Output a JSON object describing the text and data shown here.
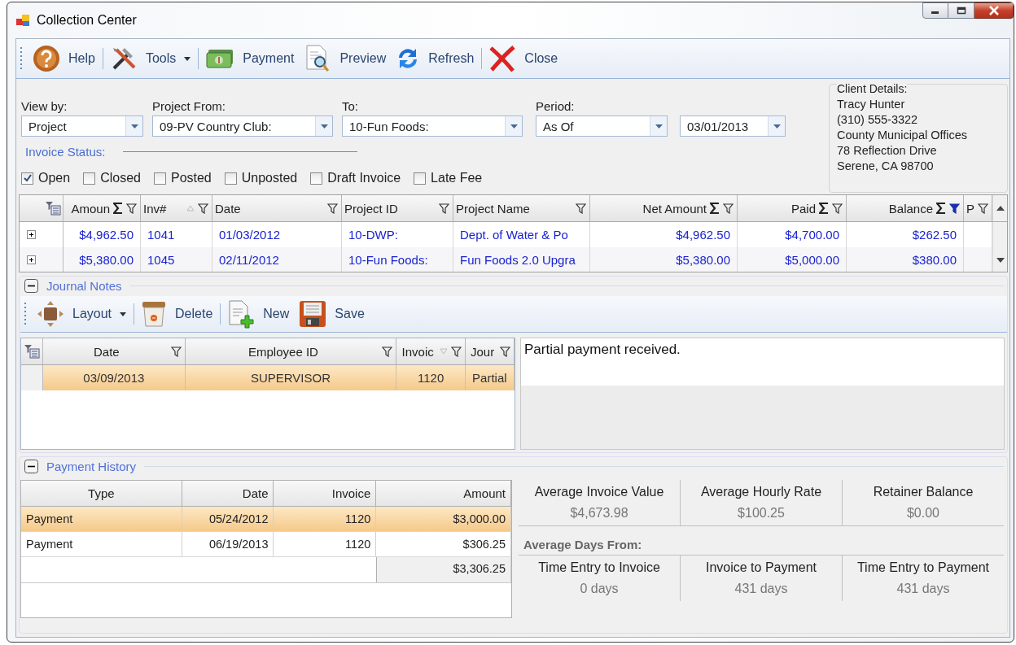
{
  "window": {
    "title": "Collection Center"
  },
  "toolbar": [
    {
      "label": "Help",
      "kind": "help",
      "dropdown": false,
      "separator": true
    },
    {
      "label": "Tools",
      "kind": "tools",
      "dropdown": true,
      "separator": true
    },
    {
      "label": "Payment",
      "kind": "money",
      "dropdown": false,
      "separator": false
    },
    {
      "label": "Preview",
      "kind": "preview",
      "dropdown": false,
      "separator": false
    },
    {
      "label": "Refresh",
      "kind": "refresh",
      "dropdown": false,
      "separator": true
    },
    {
      "label": "Close",
      "kind": "close",
      "dropdown": false,
      "separator": false
    }
  ],
  "filters": [
    {
      "label": "View by:",
      "value": "Project"
    },
    {
      "label": "Project From:",
      "value": "09-PV Country Club:"
    },
    {
      "label": "To:",
      "value": "10-Fun Foods:"
    },
    {
      "label": "Period:",
      "value": "As Of"
    },
    {
      "value": "03/01/2013"
    }
  ],
  "invoice_status": {
    "label": "Invoice Status:",
    "options": [
      {
        "label": "Open",
        "checked": true
      },
      {
        "label": "Closed",
        "checked": false
      },
      {
        "label": "Posted",
        "checked": false
      },
      {
        "label": "Unposted",
        "checked": false
      },
      {
        "label": "Draft Invoice",
        "checked": false
      },
      {
        "label": "Late Fee",
        "checked": false
      }
    ]
  },
  "client_details": {
    "label": "Client Details:",
    "lines": [
      "Tracy Hunter",
      "(310) 555-3322",
      "County Municipal Offices",
      "78 Reflection Drive",
      "Serene, CA 98700"
    ]
  },
  "invoices": {
    "columns": [
      {
        "label": "Amoun",
        "sum": true,
        "filtered": false,
        "sorted": false
      },
      {
        "label": "Inv#",
        "sum": false,
        "filtered": false,
        "sorted": true
      },
      {
        "label": "Date",
        "sum": false,
        "filtered": false,
        "sorted": false
      },
      {
        "label": "Project ID",
        "sum": false,
        "filtered": false,
        "sorted": false
      },
      {
        "label": "Project Name",
        "sum": false,
        "filtered": false,
        "sorted": false
      },
      {
        "label": "Net Amount",
        "sum": true,
        "filtered": false,
        "sorted": false
      },
      {
        "label": "Paid",
        "sum": true,
        "filtered": false,
        "sorted": false
      },
      {
        "label": "Balance",
        "sum": true,
        "filtered": true,
        "sorted": false
      },
      {
        "label": "P",
        "sum": false,
        "filtered": false,
        "sorted": false
      }
    ],
    "rows": [
      {
        "cells": [
          "$4,962.50",
          "1041",
          "01/03/2012",
          "10-DWP:",
          "Dept. of Water & Po",
          "$4,962.50",
          "$4,700.00",
          "$262.50",
          ""
        ]
      },
      {
        "cells": [
          "$5,380.00",
          "1045",
          "02/11/2012",
          "10-Fun Foods:",
          "Fun Foods 2.0 Upgra",
          "$5,380.00",
          "$5,000.00",
          "$380.00",
          ""
        ]
      }
    ]
  },
  "journal": {
    "title": "Journal Notes",
    "expanded": true,
    "toolbar": [
      {
        "label": "Layout",
        "kind": "layout",
        "dropdown": true,
        "separator": true
      },
      {
        "label": "Delete",
        "kind": "delete",
        "dropdown": false,
        "separator": true
      },
      {
        "label": "New",
        "kind": "new",
        "dropdown": false,
        "separator": false
      },
      {
        "label": "Save",
        "kind": "save",
        "dropdown": false,
        "separator": false
      }
    ],
    "columns": [
      {
        "label": "Date",
        "sorted": false
      },
      {
        "label": "Employee ID",
        "sorted": false
      },
      {
        "label": "Invoic",
        "sorted": true
      },
      {
        "label": "Jour",
        "sorted": false
      }
    ],
    "rows": [
      {
        "cells": [
          "03/09/2013",
          "SUPERVISOR",
          "1120",
          "Partial"
        ],
        "selected": true
      }
    ],
    "note": "Partial payment received."
  },
  "payment_history": {
    "title": "Payment History",
    "expanded": true,
    "columns": [
      "Type",
      "Date",
      "Invoice",
      "Amount"
    ],
    "rows": [
      {
        "cells": [
          "Payment",
          "05/24/2012",
          "1120",
          "$3,000.00"
        ],
        "selected": true
      },
      {
        "cells": [
          "Payment",
          "06/19/2013",
          "1120",
          "$306.25"
        ],
        "selected": false
      }
    ],
    "total": "$3,306.25",
    "stats": [
      {
        "label": "Average Invoice Value",
        "value": "$4,673.98"
      },
      {
        "label": "Average Hourly Rate",
        "value": "$100.25"
      },
      {
        "label": "Retainer Balance",
        "value": "$0.00"
      }
    ],
    "days_heading": "Average Days From:",
    "days": [
      {
        "label": "Time Entry to Invoice",
        "value": "0 days"
      },
      {
        "label": "Invoice to Payment",
        "value": "431 days"
      },
      {
        "label": "Time Entry to Payment",
        "value": "431 days"
      }
    ]
  }
}
